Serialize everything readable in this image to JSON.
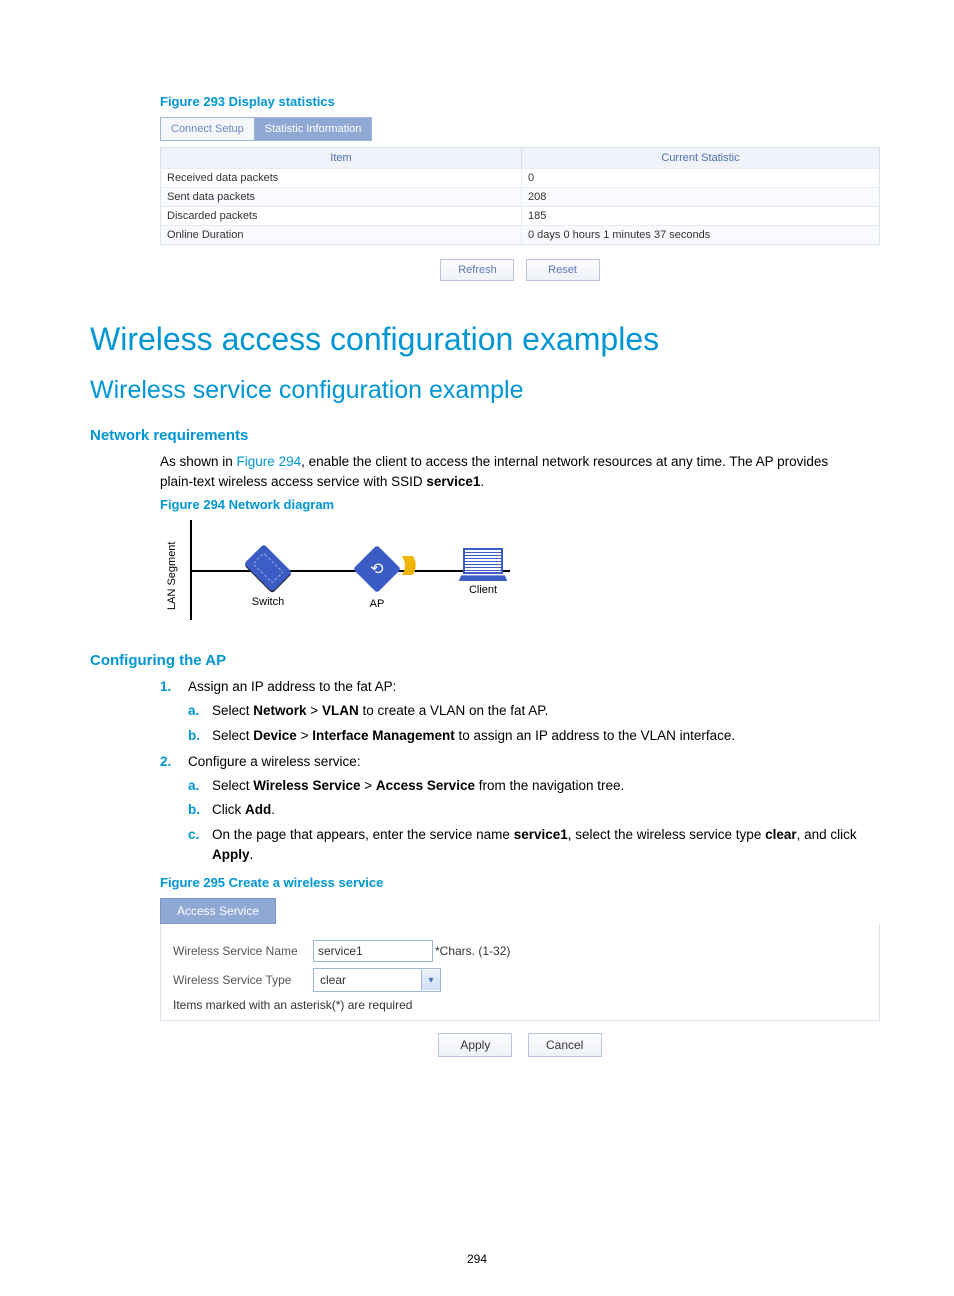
{
  "fig293": {
    "caption": "Figure 293 Display statistics",
    "tabs": {
      "inactive": "Connect Setup",
      "active": "Statistic Information"
    },
    "headers": {
      "item": "Item",
      "stat": "Current Statistic"
    },
    "rows": [
      {
        "item": "Received data packets",
        "stat": "0"
      },
      {
        "item": "Sent data packets",
        "stat": "208"
      },
      {
        "item": "Discarded packets",
        "stat": "185"
      },
      {
        "item": "Online Duration",
        "stat": "0 days 0 hours 1 minutes 37 seconds"
      }
    ],
    "buttons": {
      "refresh": "Refresh",
      "reset": "Reset"
    }
  },
  "h1": "Wireless access configuration examples",
  "h2": "Wireless service configuration example",
  "netreq": {
    "heading": "Network requirements",
    "para_pre": "As shown in ",
    "link": "Figure 294",
    "para_post": ", enable the client to access the internal network resources at any time. The AP provides plain-text wireless access service with SSID ",
    "ssid": "service1",
    "period": "."
  },
  "fig294": {
    "caption": "Figure 294 Network diagram",
    "segment": "LAN Segment",
    "switch": "Switch",
    "ap": "AP",
    "client": "Client"
  },
  "cfg": {
    "heading": "Configuring the AP",
    "step1": {
      "text": "Assign an IP address to the fat AP:",
      "a_pre": "Select ",
      "a_b1": "Network",
      "a_mid": " > ",
      "a_b2": "VLAN",
      "a_post": " to create a VLAN on the fat AP.",
      "b_pre": "Select ",
      "b_b1": "Device",
      "b_mid": " > ",
      "b_b2": "Interface Management",
      "b_post": " to assign an IP address to the VLAN interface."
    },
    "step2": {
      "text": "Configure a wireless service:",
      "a_pre": "Select ",
      "a_b1": "Wireless Service",
      "a_mid": " > ",
      "a_b2": "Access Service",
      "a_post": " from the navigation tree.",
      "b_pre": "Click ",
      "b_b1": "Add",
      "b_post": ".",
      "c_pre": "On the page that appears, enter the service name ",
      "c_b1": "service1",
      "c_mid": ", select the wireless service type ",
      "c_b2": "clear",
      "c_post": ", and click ",
      "c_b3": "Apply",
      "c_end": "."
    }
  },
  "fig295": {
    "caption": "Figure 295 Create a wireless service",
    "tab": "Access Service",
    "name_label": "Wireless Service Name",
    "name_value": "service1",
    "name_hint": "*Chars. (1-32)",
    "type_label": "Wireless Service Type",
    "type_value": "clear",
    "note": "Items marked with an asterisk(*) are required",
    "apply": "Apply",
    "cancel": "Cancel"
  },
  "pagenum": "294"
}
